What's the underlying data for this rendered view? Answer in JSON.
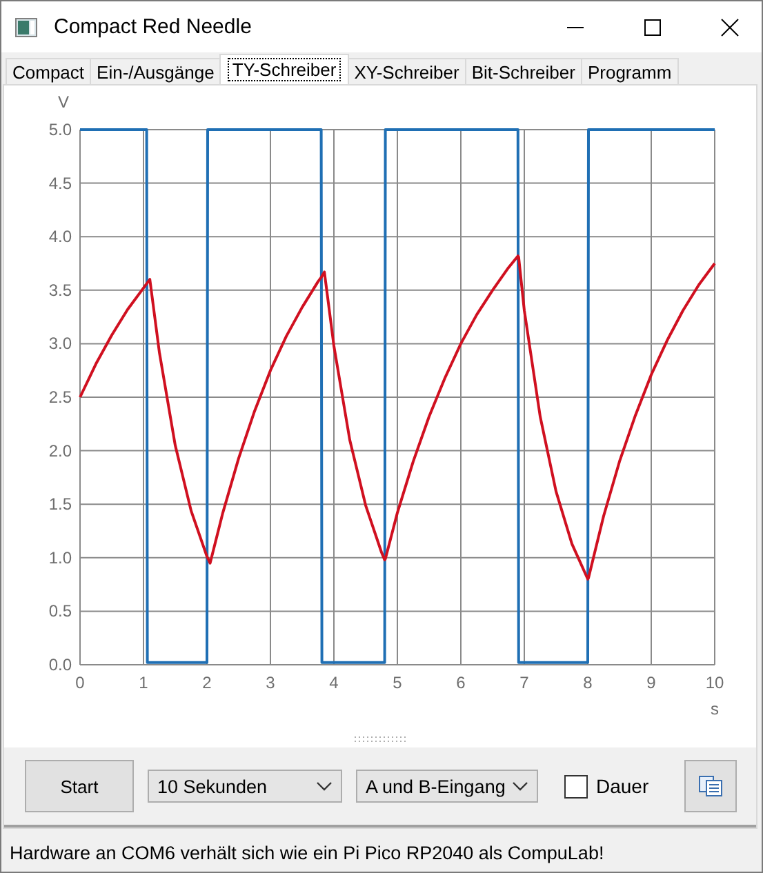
{
  "window": {
    "title": "Compact Red Needle"
  },
  "tabs": [
    {
      "label": "Compact",
      "selected": false
    },
    {
      "label": "Ein-/Ausgänge",
      "selected": false
    },
    {
      "label": "TY-Schreiber",
      "selected": true
    },
    {
      "label": "XY-Schreiber",
      "selected": false
    },
    {
      "label": "Bit-Schreiber",
      "selected": false
    },
    {
      "label": "Programm",
      "selected": false
    }
  ],
  "chart": {
    "chart_data": {
      "type": "line",
      "grid": true,
      "ylabel": "V",
      "xlabel": "s",
      "xlim": [
        0,
        10
      ],
      "ylim": [
        0,
        5
      ],
      "xticks": [
        0,
        1,
        2,
        3,
        4,
        5,
        6,
        7,
        8,
        9,
        10
      ],
      "yticks": [
        {
          "value": 0,
          "label": "0.0"
        },
        {
          "value": 0.5,
          "label": "0.5"
        },
        {
          "value": 1,
          "label": "1.0"
        },
        {
          "value": 1.5,
          "label": "1.5"
        },
        {
          "value": 2,
          "label": "2.0"
        },
        {
          "value": 2.5,
          "label": "2.5"
        },
        {
          "value": 3,
          "label": "3.0"
        },
        {
          "value": 3.5,
          "label": "3.5"
        },
        {
          "value": 4,
          "label": "4.0"
        },
        {
          "value": 4.5,
          "label": "4.5"
        },
        {
          "value": 5,
          "label": "5.0"
        }
      ],
      "x": [
        0,
        0.25,
        0.5,
        0.75,
        1.0,
        1.05,
        1.06,
        1.1,
        1.25,
        1.5,
        1.75,
        2.0,
        2.01,
        2.05,
        2.25,
        2.5,
        2.75,
        3.0,
        3.25,
        3.5,
        3.75,
        3.8,
        3.81,
        3.85,
        4.0,
        4.25,
        4.5,
        4.75,
        4.8,
        4.81,
        5.0,
        5.25,
        5.5,
        5.75,
        6.0,
        6.25,
        6.5,
        6.75,
        6.9,
        6.91,
        7.0,
        7.25,
        7.5,
        7.75,
        8.0,
        8.01,
        8.25,
        8.5,
        8.75,
        9.0,
        9.25,
        9.5,
        9.75,
        10.0
      ],
      "series": [
        {
          "color": "#1f6fb4",
          "values": [
            5,
            5,
            5,
            5,
            5,
            5,
            0.02,
            0.02,
            0.02,
            0.02,
            0.02,
            0.02,
            5,
            5,
            5,
            5,
            5,
            5,
            5,
            5,
            5,
            5,
            0.02,
            0.02,
            0.02,
            0.02,
            0.02,
            0.02,
            0.02,
            5,
            5,
            5,
            5,
            5,
            5,
            5,
            5,
            5,
            5,
            0.02,
            0.02,
            0.02,
            0.02,
            0.02,
            0.02,
            5,
            5,
            5,
            5,
            5,
            5,
            5,
            5,
            5
          ]
        },
        {
          "color": "#d01020",
          "values": [
            2.5,
            2.81,
            3.08,
            3.32,
            3.52,
            3.56,
            3.57,
            3.6,
            2.92,
            2.05,
            1.44,
            1.01,
            1.0,
            0.95,
            1.42,
            1.93,
            2.37,
            2.75,
            3.07,
            3.34,
            3.58,
            3.62,
            3.63,
            3.67,
            2.98,
            2.1,
            1.49,
            1.05,
            0.98,
            0.99,
            1.42,
            1.9,
            2.32,
            2.68,
            3.0,
            3.27,
            3.5,
            3.71,
            3.82,
            3.81,
            3.31,
            2.32,
            1.62,
            1.13,
            0.8,
            0.81,
            1.39,
            1.9,
            2.33,
            2.71,
            3.03,
            3.31,
            3.55,
            3.75
          ]
        }
      ]
    }
  },
  "controls": {
    "start_button": "Start",
    "duration": {
      "value": "10 Sekunden"
    },
    "input": {
      "value": "A und B-Eingang"
    },
    "continuous": {
      "label": "Dauer",
      "checked": false
    }
  },
  "status_bar": "Hardware an COM6 verhält sich wie ein Pi Pico RP2040 als CompuLab!"
}
